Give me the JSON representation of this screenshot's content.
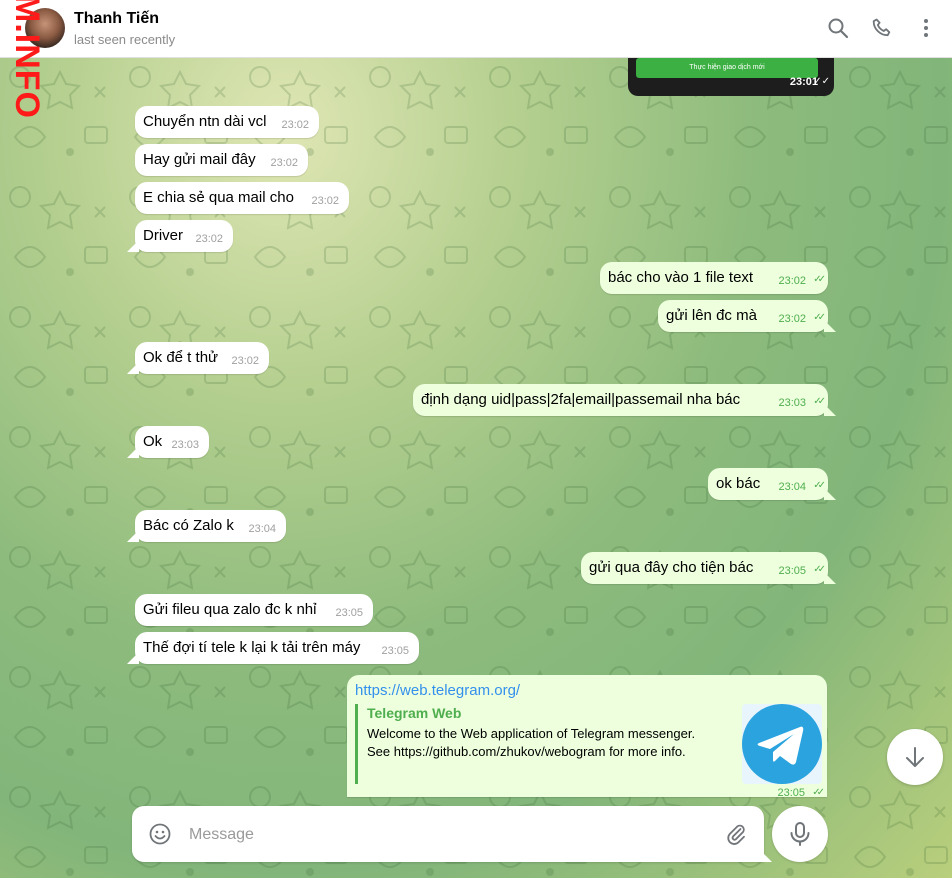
{
  "header": {
    "name": "Thanh Tiến",
    "status": "last seen recently",
    "watermark": "M.INFO"
  },
  "image_message": {
    "button_text": "Thực hiện giao dịch mới",
    "time": "23:01",
    "ticks": "✓✓"
  },
  "messages": [
    {
      "text": "Chuyển ntn dài vcl",
      "time": "23:02"
    },
    {
      "text": "Hay gửi mail đây",
      "time": "23:02"
    },
    {
      "text": "E chia sẻ qua mail cho",
      "time": "23:02"
    },
    {
      "text": "Driver",
      "time": "23:02"
    },
    {
      "text": "bác cho vào 1 file text",
      "time": "23:02",
      "ticks": "✓✓"
    },
    {
      "text": "gửi lên đc mà",
      "time": "23:02",
      "ticks": "✓✓"
    },
    {
      "text": "Ok để t thử",
      "time": "23:02"
    },
    {
      "text": "định dạng uid|pass|2fa|email|passemail nha bác",
      "time": "23:03",
      "ticks": "✓✓"
    },
    {
      "text": "Ok",
      "time": "23:03"
    },
    {
      "text": "ok bác",
      "time": "23:04",
      "ticks": "✓✓"
    },
    {
      "text": "Bác có Zalo k",
      "time": "23:04"
    },
    {
      "text": "gửi qua đây cho tiện bác",
      "time": "23:05",
      "ticks": "✓✓"
    },
    {
      "text": "Gửi fileu qua zalo đc k nhỉ",
      "time": "23:05"
    },
    {
      "text": "Thế đợi tí tele k lại k tải trên máy",
      "time": "23:05"
    }
  ],
  "link_message": {
    "url": "https://web.telegram.org/",
    "preview_title": "Telegram Web",
    "preview_line1": "Welcome to the Web application of Telegram messenger.",
    "preview_line2": "See https://github.com/zhukov/webogram for more info.",
    "time": "23:05",
    "ticks": "✓✓"
  },
  "composer": {
    "placeholder": "Message"
  },
  "colors": {
    "outgoing_bubble": "#eeffde",
    "incoming_bubble": "#ffffff",
    "accent_green": "#4fae4e",
    "link_blue": "#3390ec",
    "telegram_blue": "#2aa3df"
  },
  "icons": [
    "search-icon",
    "phone-icon",
    "more-vertical-icon",
    "emoji-icon",
    "attach-icon",
    "microphone-icon",
    "arrow-down-icon",
    "telegram-logo-icon"
  ]
}
